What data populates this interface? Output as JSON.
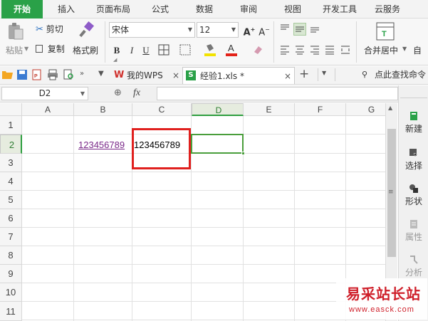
{
  "menu": {
    "tabs": [
      "开始",
      "插入",
      "页面布局",
      "公式",
      "数据",
      "审阅",
      "视图",
      "开发工具",
      "云服务"
    ],
    "active_index": 0
  },
  "ribbon": {
    "paste_label": "粘贴",
    "cut_label": "剪切",
    "copy_label": "复制",
    "format_painter_label": "格式刷",
    "font_name": "宋体",
    "font_size": "12",
    "bold": "B",
    "italic": "I",
    "underline": "U",
    "merge_label": "合并居中",
    "merge_extra": "自"
  },
  "quickbar": {
    "doc_tabs": [
      {
        "label": "我的WPS"
      },
      {
        "label": "经验1.xls *"
      }
    ],
    "search_label": "点此查找命令"
  },
  "formula": {
    "name_box": "D2",
    "fx_label": "fx",
    "value": ""
  },
  "sheet": {
    "columns": [
      "A",
      "B",
      "C",
      "D",
      "E",
      "F",
      "G"
    ],
    "rows": [
      "1",
      "2",
      "3",
      "4",
      "5",
      "6",
      "7",
      "8",
      "9",
      "10",
      "11"
    ],
    "selected_column": "D",
    "selected_row": "2",
    "cells": {
      "B2": "123456789",
      "C2": "123456789"
    }
  },
  "side_panel": {
    "items": [
      "新建",
      "选择",
      "形状",
      "属性",
      "分析"
    ]
  },
  "watermark": {
    "title": "易采站长站",
    "url": "www.easck.com"
  },
  "colors": {
    "accent_green": "#2aa148",
    "highlight_red": "#e0201e",
    "hyperlink_purple": "#7b2a8a",
    "active_cell_green": "#4a9e3c"
  }
}
